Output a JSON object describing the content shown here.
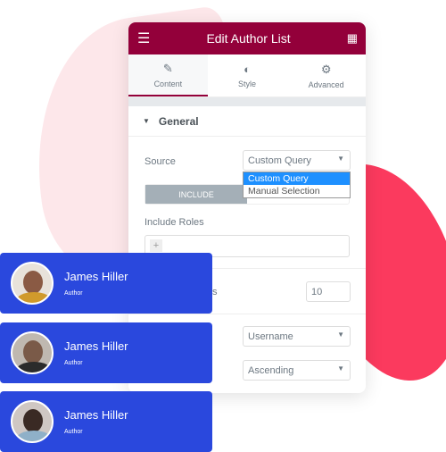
{
  "panel": {
    "title": "Edit Author List",
    "tabs": [
      {
        "label": "Content",
        "icon": "pencil-icon"
      },
      {
        "label": "Style",
        "icon": "half-circle-icon"
      },
      {
        "label": "Advanced",
        "icon": "gear-icon"
      }
    ],
    "section": "General",
    "source_label": "Source",
    "source_value": "Custom Query",
    "source_options": [
      "Custom Query",
      "Manual Selection"
    ],
    "include_label": "INCLUDE",
    "include_roles_label": "Include Roles",
    "partial_label": "s",
    "number_value": "10",
    "orderby_value": "Username",
    "order_value": "Ascending"
  },
  "colors": {
    "header": "#93003a",
    "card": "#2a48dd",
    "blob": "#fb3a5e"
  },
  "authors": [
    {
      "name": "James Hiller",
      "role": "Author"
    },
    {
      "name": "James Hiller",
      "role": "Author"
    },
    {
      "name": "James Hiller",
      "role": "Author"
    }
  ]
}
